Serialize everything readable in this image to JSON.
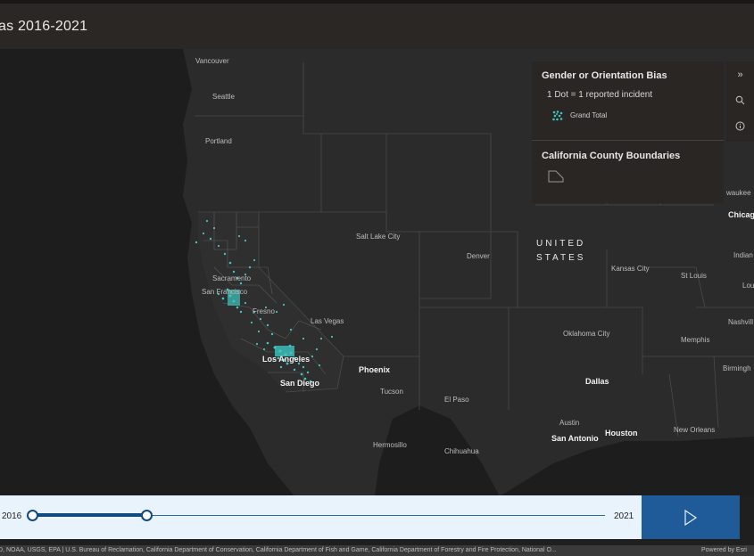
{
  "header": {
    "title": "as 2016-2021"
  },
  "legend": {
    "layer1_title": "Gender or Orientation Bias",
    "layer1_subtitle": "1 Dot = 1 reported incident",
    "layer1_item": "Grand Total",
    "layer2_title": "California County Boundaries",
    "dot_color": "#3fc6c0"
  },
  "widgets": [
    "expand-icon",
    "search-icon",
    "info-icon"
  ],
  "map_labels": {
    "vancouver": "Vancouver",
    "seattle": "Seattle",
    "portland": "Portland",
    "salt_lake_city": "Salt Lake City",
    "denver": "Denver",
    "united": "UNITED",
    "states": "STATES",
    "kansas_city": "Kansas City",
    "st_louis": "St Louis",
    "chicago": "Chicago",
    "waukee": "waukee",
    "indian": "Indian",
    "lou": "Lou",
    "nashvill": "Nashvill",
    "memphis": "Memphis",
    "birmingh": "Birmingh",
    "sacramento": "Sacramento",
    "san_francisco": "San Francisco",
    "fresno": "Fresno",
    "las_vegas": "Las Vegas",
    "los_angeles": "Los Angeles",
    "san_diego": "San Diego",
    "phoenix": "Phoenix",
    "tucson": "Tucson",
    "el_paso": "El Paso",
    "oklahoma_city": "Oklahoma City",
    "dallas": "Dallas",
    "austin": "Austin",
    "san_antonio": "San Antonio",
    "houston": "Houston",
    "new_orleans": "New Orleans",
    "hermosillo": "Hermosillo",
    "chihuahua": "Chihuahua"
  },
  "timeline": {
    "start_label": "2016",
    "end_label": "2021",
    "play_icon": "play-icon"
  },
  "attribution": {
    "sources": "D, NOAA, USGS, EPA | U.S. Bureau of Reclamation, California Department of Conservation, California Department of Fish and Game, California Department of Forestry and Fire Protection, National O...",
    "powered_by": "Powered by Esri"
  }
}
